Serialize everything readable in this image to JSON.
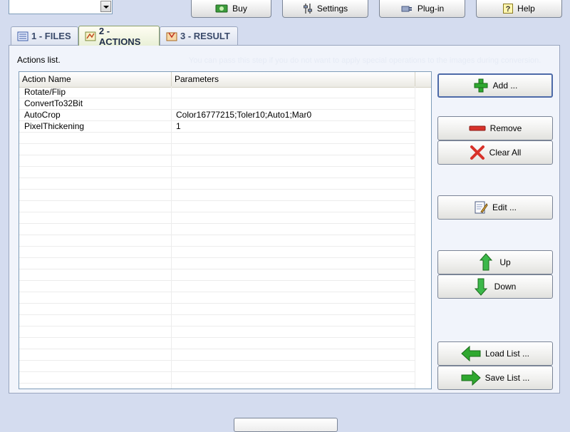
{
  "toolbar": {
    "combo_value": "",
    "buy_label": "Buy",
    "settings_label": "Settings",
    "plugin_label": "Plug-in",
    "help_label": "Help"
  },
  "tabs": [
    {
      "label": "1 - FILES",
      "icon": "files-icon",
      "active": false
    },
    {
      "label": "2 - ACTIONS",
      "icon": "actions-icon",
      "active": true
    },
    {
      "label": "3 - RESULT",
      "icon": "result-icon",
      "active": false
    }
  ],
  "panel": {
    "title": "Actions list.",
    "hint": "You can pass this step if you do not want to apply special operations to the images during conversion."
  },
  "list": {
    "columns": [
      "Action Name",
      "Parameters"
    ],
    "rows": [
      {
        "name": "Rotate/Flip",
        "params": ""
      },
      {
        "name": "ConvertTo32Bit",
        "params": ""
      },
      {
        "name": "AutoCrop",
        "params": "Color16777215;Toler10;Auto1;Mar0"
      },
      {
        "name": "PixelThickening",
        "params": "1"
      }
    ]
  },
  "actions": {
    "add_label": "Add ...",
    "remove_label": "Remove",
    "clear_label": "Clear All",
    "edit_label": "Edit ...",
    "up_label": "Up",
    "down_label": "Down",
    "load_label": "Load List ...",
    "save_label": "Save List ..."
  },
  "colors": {
    "background": "#d4dcef",
    "panel": "#f1f4fb",
    "green_icon": "#2fa82f",
    "red_icon": "#d8322a"
  }
}
